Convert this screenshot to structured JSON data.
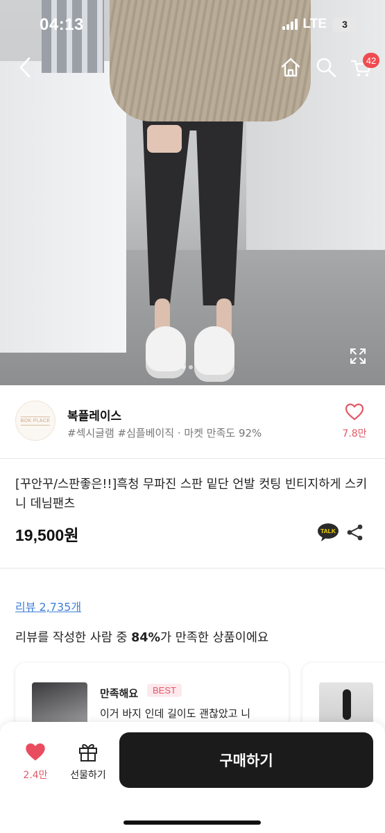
{
  "status_bar": {
    "time": "04:13",
    "network": "LTE",
    "battery": "3"
  },
  "top_nav": {
    "cart_count": "42"
  },
  "store": {
    "logo_text": "BOK PLACE",
    "name": "복플레이스",
    "tags": "#섹시글램 #심플베이직 · 마켓 만족도 92%",
    "like_count": "7.8만"
  },
  "product": {
    "title": "[꾸안꾸/스판좋은!!]흑청 무파진 스판 밑단 언발 컷팅 빈티지하게 스키니 데님팬츠",
    "price": "19,500원",
    "talk_label": "TALK"
  },
  "reviews": {
    "link": "리뷰 2,735개",
    "summary_prefix": "리뷰를 작성한 사람 중 ",
    "summary_percent": "84%",
    "summary_suffix": "가 만족한 상품이에요",
    "items": [
      {
        "rating": "만족해요",
        "badge": "BEST",
        "text": "이거 바지 인데 길이도 괜찮았고 니"
      }
    ]
  },
  "bottom_bar": {
    "like_count": "2.4만",
    "gift_label": "선물하기",
    "buy_label": "구매하기"
  },
  "colors": {
    "accent": "#e05a66",
    "badge": "#f04b50",
    "link": "#3f7fd9",
    "buy_button": "#1b1b1b"
  }
}
